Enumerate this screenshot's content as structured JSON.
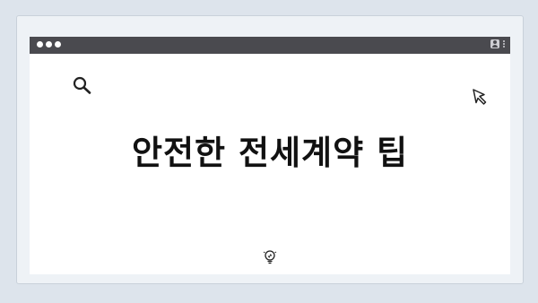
{
  "frame": {
    "window_controls": [
      "close",
      "minimize",
      "maximize"
    ],
    "icons": {
      "search": "search-icon",
      "cursor": "cursor-arrow-icon",
      "profile": "profile-icon",
      "menu": "kebab-menu-icon",
      "hint": "lightbulb-icon"
    }
  },
  "main": {
    "title": "안전한 전세계약 팁"
  },
  "colors": {
    "background": "#dde4ec",
    "titlebar": "#4a4a4f",
    "content": "#ffffff",
    "text": "#111111"
  }
}
